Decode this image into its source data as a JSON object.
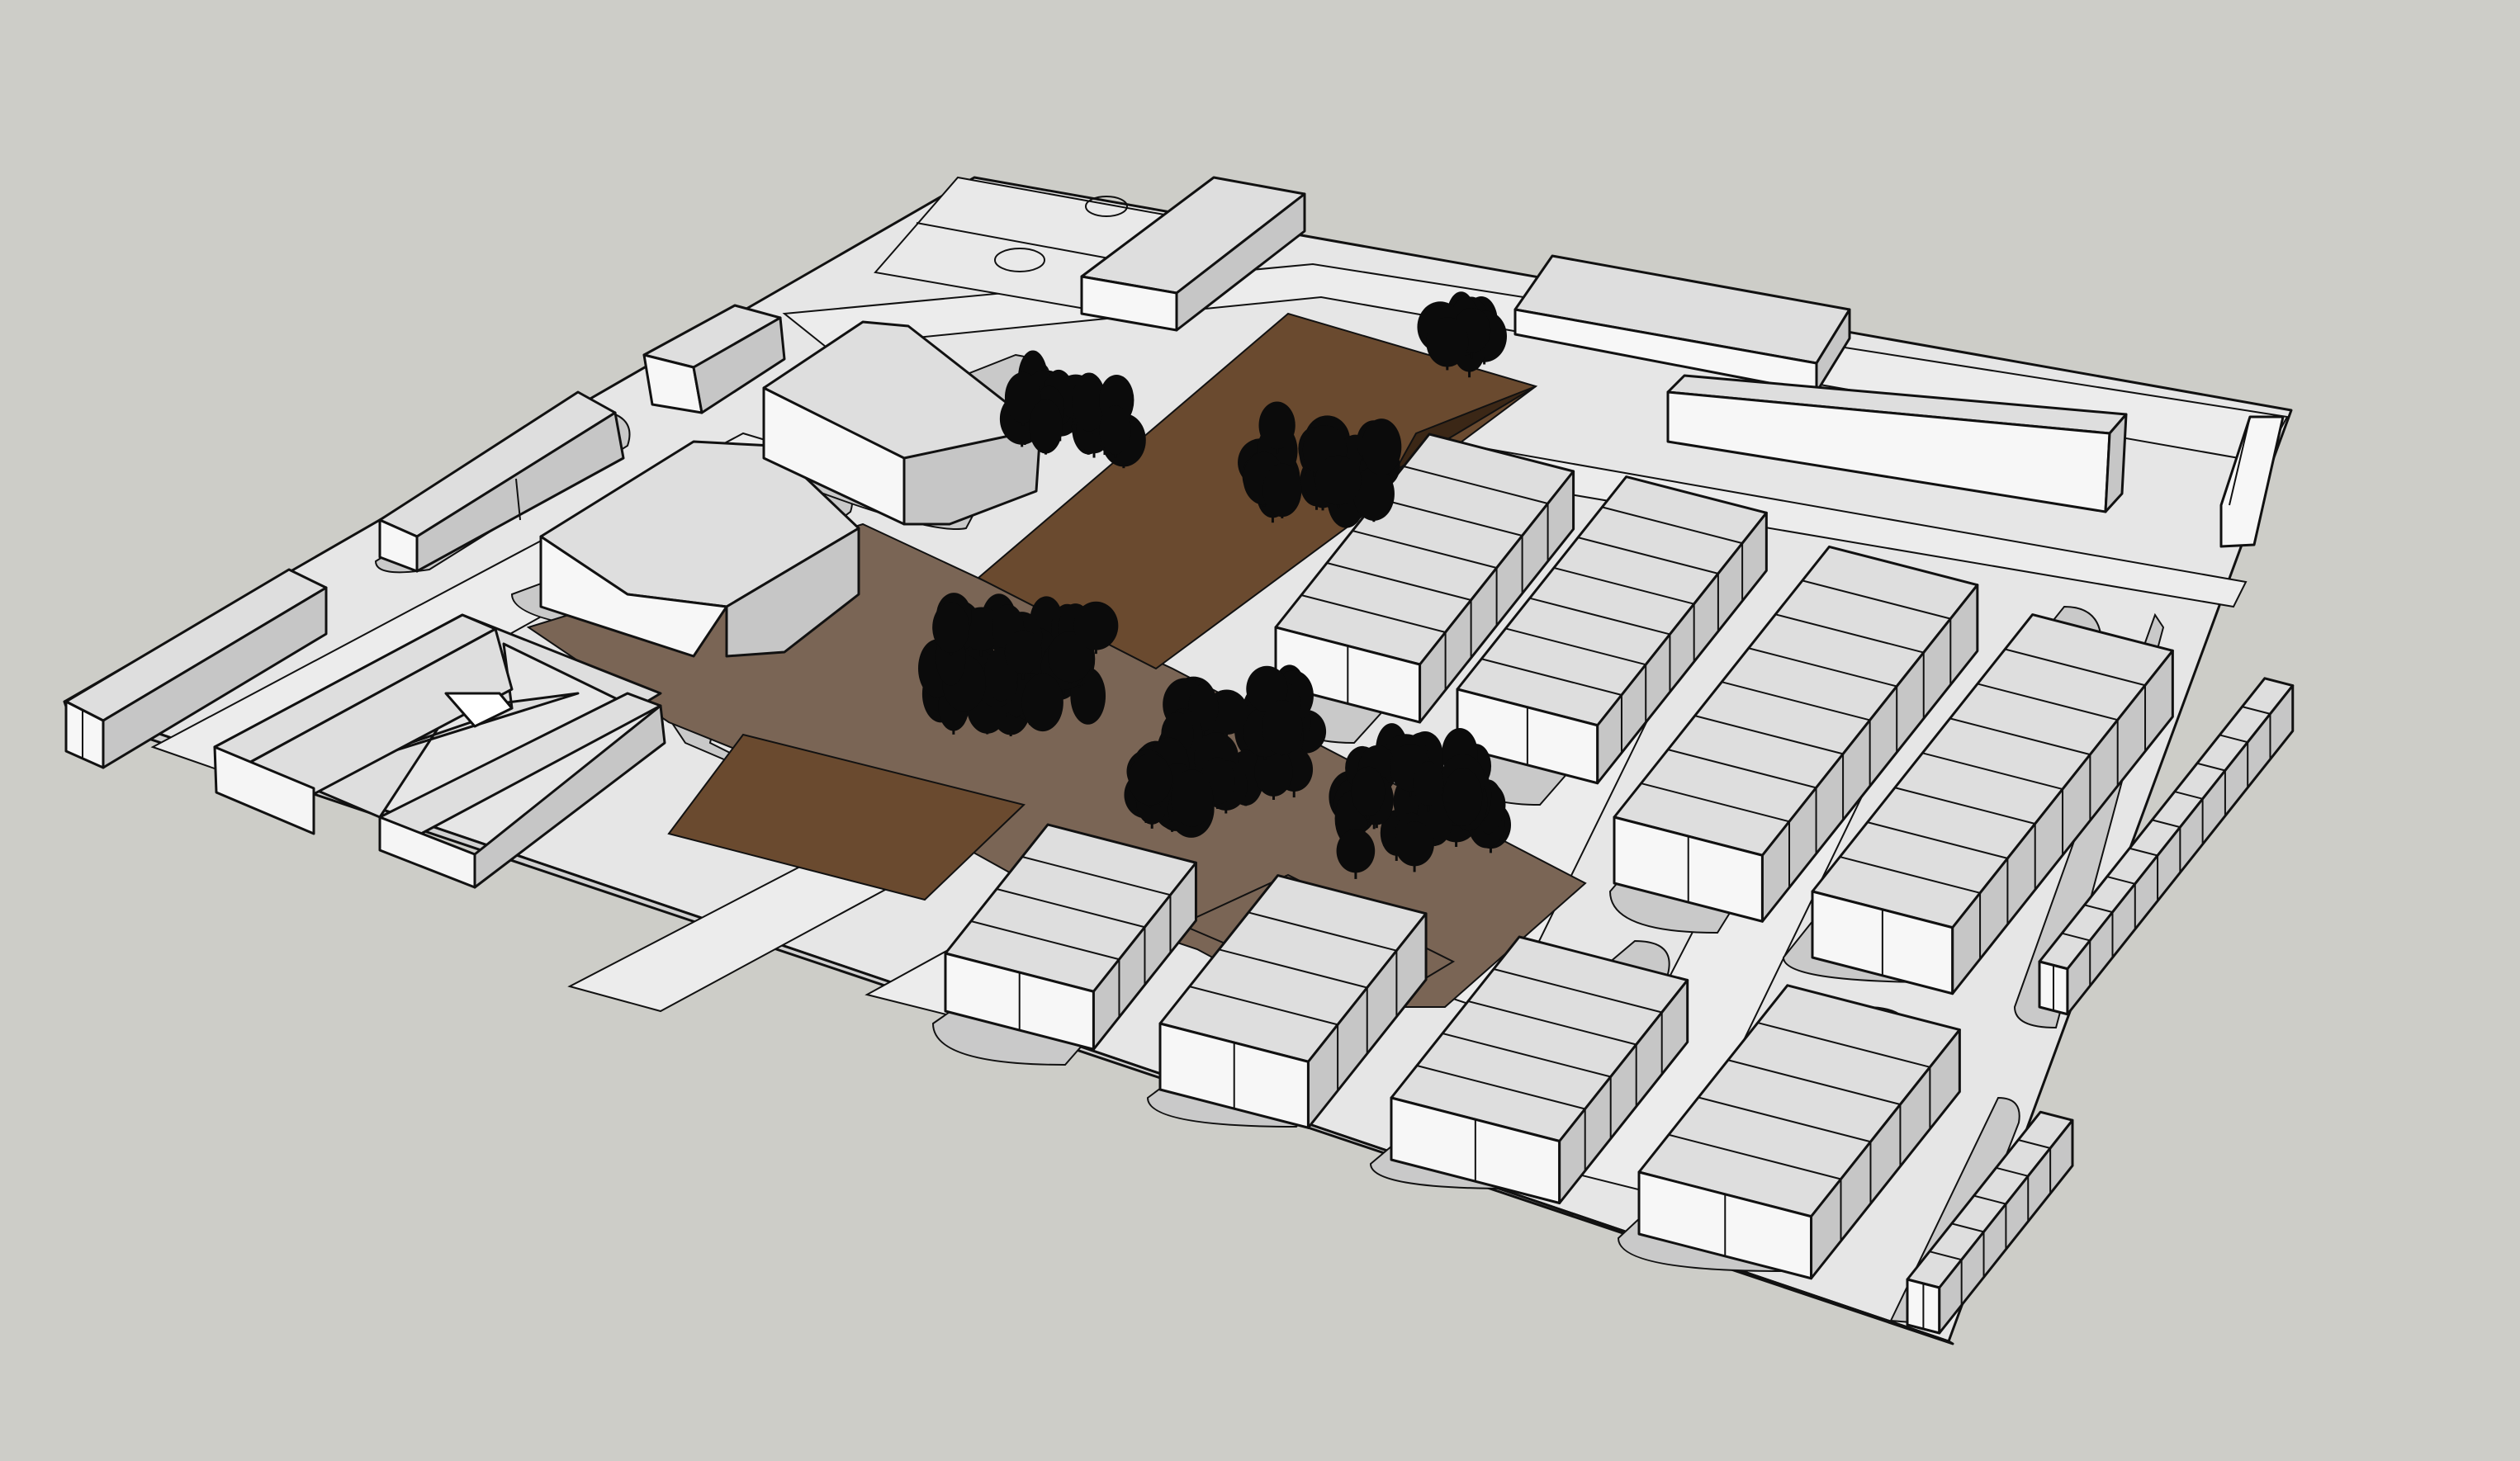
{
  "scene": {
    "background": "#cdcdc8",
    "ground_color": "#dcdcdc",
    "street_color": "#e9e9e9",
    "sidewalk_color": "#c9c9c9",
    "roof_color": "#dedede",
    "wall_light": "#f7f7f7",
    "wall_shade": "#c6c6c6",
    "plaza_dark": "#6a4a2f",
    "plaza_light": "#7a6555",
    "plaza_deep": "#3b2716",
    "tree_color": "#0b0b0b"
  },
  "labels": {}
}
